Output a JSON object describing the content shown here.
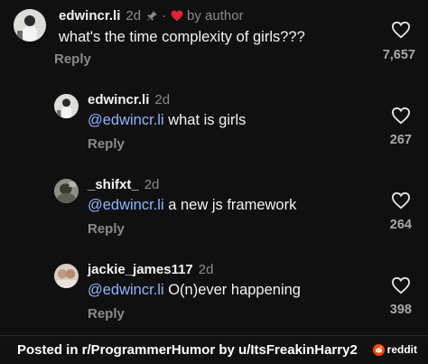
{
  "comments": [
    {
      "username": "edwincr.li",
      "time": "2d",
      "dot": "·",
      "by_author": "by author",
      "mention": "",
      "text": "what's the time complexity of girls???",
      "reply": "Reply",
      "likes": "7,657"
    },
    {
      "username": "edwincr.li",
      "time": "2d",
      "mention": "@edwincr.li",
      "text": " what is girls",
      "reply": "Reply",
      "likes": "267"
    },
    {
      "username": "_shifxt_",
      "time": "2d",
      "mention": "@edwincr.li",
      "text": " a new js framework",
      "reply": "Reply",
      "likes": "264"
    },
    {
      "username": "jackie_james117",
      "time": "2d",
      "mention": "@edwincr.li",
      "text": " O(n)ever happening",
      "reply": "Reply",
      "likes": "398"
    }
  ],
  "footer": {
    "text": "Posted in r/ProgrammerHumor by u/ItsFreakinHarry2",
    "reddit_label": "reddit"
  },
  "colors": {
    "mention": "#8fb3ff",
    "heart": "#e0243a",
    "reddit": "#ff4500"
  }
}
